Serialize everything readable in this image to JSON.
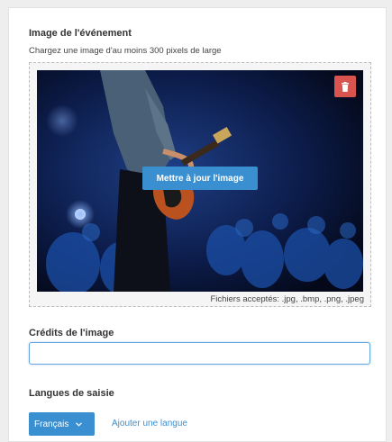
{
  "image_section": {
    "title": "Image de l'événement",
    "hint": "Chargez une image d'au moins 300 pixels de large",
    "update_button": "Mettre à jour l'image",
    "delete_icon": "trash-icon",
    "accepted_formats": "Fichiers acceptés:  .jpg, .bmp, .png, .jpeg"
  },
  "credits_section": {
    "title": "Crédits de l'image",
    "value": ""
  },
  "languages_section": {
    "title": "Langues de saisie",
    "selected_language": "Français",
    "chevron_icon": "chevron-down-icon",
    "add_language_link": "Ajouter une langue"
  },
  "colors": {
    "accent": "#3a8fd1",
    "danger": "#d9534f"
  }
}
